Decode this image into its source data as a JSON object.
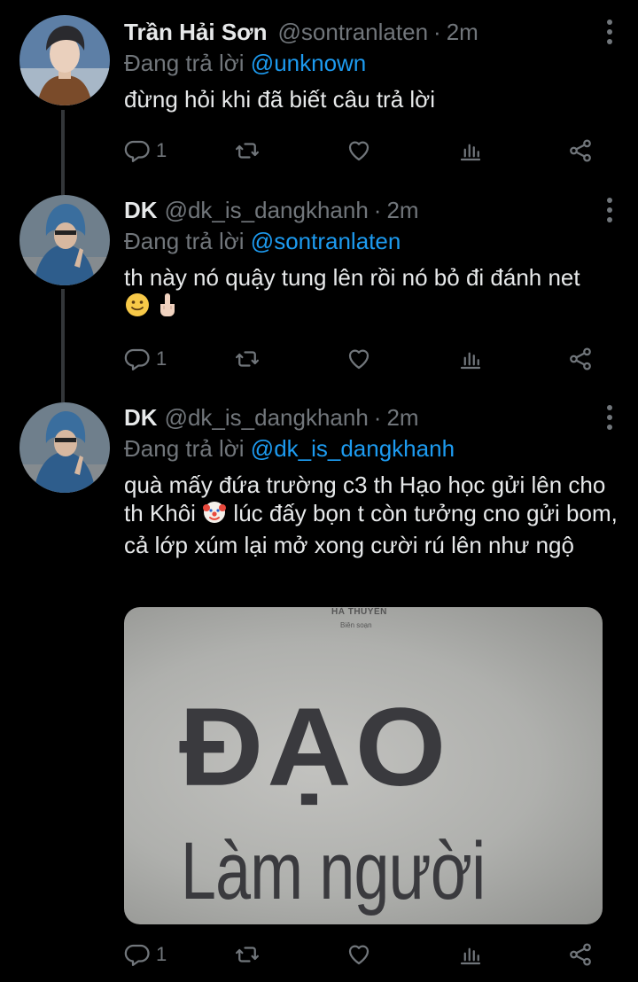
{
  "tweets": [
    {
      "name": "Trần Hải Sơn",
      "handle": "@sontranlaten",
      "time": "2m",
      "reply_prefix": "Đang trả lời",
      "reply_to": "@unknown",
      "text": "đừng hỏi khi đã biết câu trả lời",
      "emojis": [],
      "reply_count": "1"
    },
    {
      "name": "DK",
      "handle": "@dk_is_dangkhanh",
      "time": "2m",
      "reply_prefix": "Đang trả lời",
      "reply_to": "@sontranlaten",
      "text": "th này nó quậy tung lên rồi nó bỏ đi đánh net",
      "emojis": [
        "slightly-smiling-face-emoji",
        "middle-finger-emoji"
      ],
      "reply_count": "1"
    },
    {
      "name": "DK",
      "handle": "@dk_is_dangkhanh",
      "time": "2m",
      "reply_prefix": "Đang trả lời",
      "reply_to": "@dk_is_dangkhanh",
      "text_before_emoji": "quà mấy đứa trường c3 th Hạo học gửi lên cho th Khôi",
      "text_after_emoji": "lúc đấy bọn t còn tưởng cno gửi bom, cả lớp xúm lại mở xong cười rú lên như ngộ",
      "emojis": [
        "clown-face-emoji"
      ],
      "reply_count": "1",
      "media": {
        "author_line": "HÀ THUYÊN",
        "editor_line": "Biên soạn",
        "title": "ĐẠO",
        "subtitle": "Làm người"
      }
    }
  ],
  "colors": {
    "background": "#000000",
    "text": "#e7e9ea",
    "secondary": "#71767b",
    "link": "#1d9bf0",
    "thread_line": "#333639"
  }
}
